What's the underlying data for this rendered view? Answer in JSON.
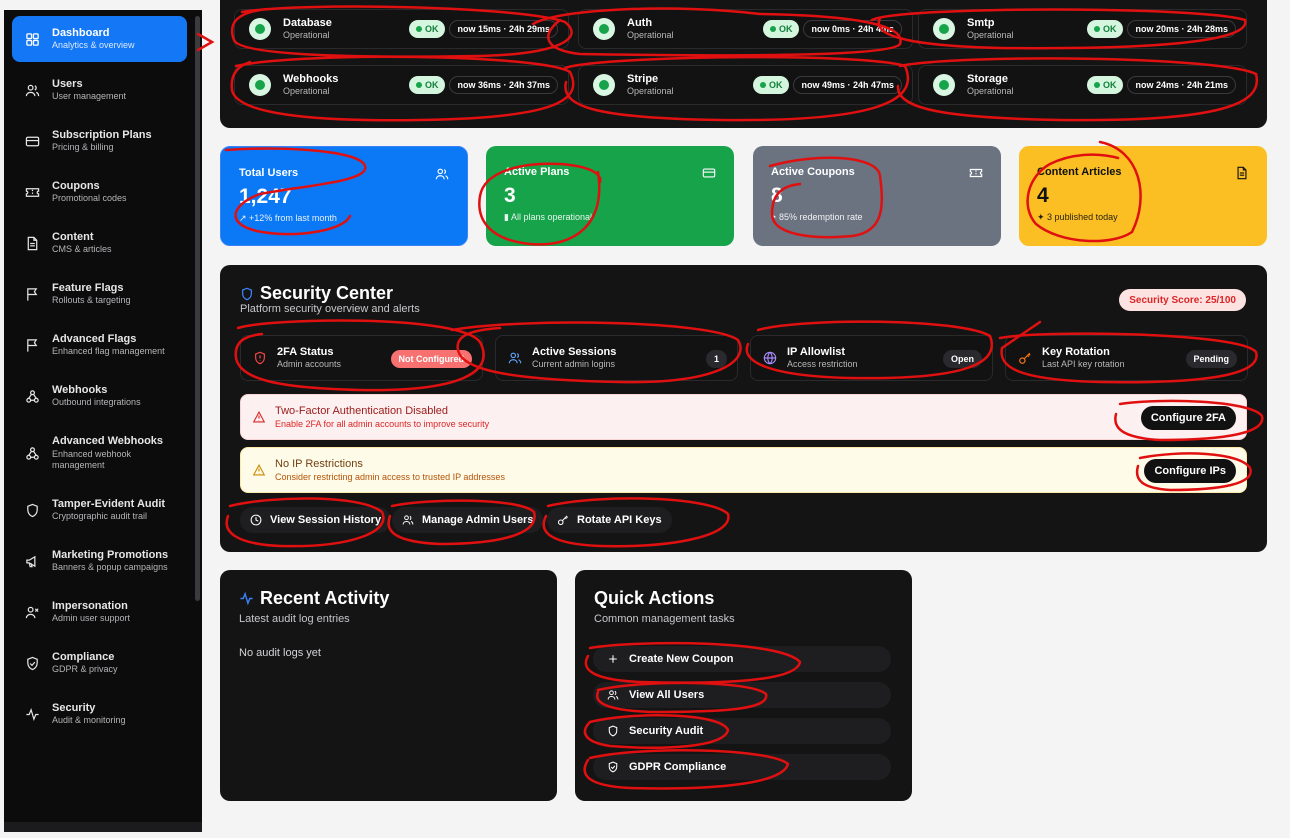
{
  "sidebar": {
    "items": [
      {
        "label": "Dashboard",
        "sub": "Analytics & overview",
        "icon": "grid-icon"
      },
      {
        "label": "Users",
        "sub": "User management",
        "icon": "users-icon"
      },
      {
        "label": "Subscription Plans",
        "sub": "Pricing & billing",
        "icon": "credit-card-icon"
      },
      {
        "label": "Coupons",
        "sub": "Promotional codes",
        "icon": "ticket-icon"
      },
      {
        "label": "Content",
        "sub": "CMS & articles",
        "icon": "file-icon"
      },
      {
        "label": "Feature Flags",
        "sub": "Rollouts & targeting",
        "icon": "flag-icon"
      },
      {
        "label": "Advanced Flags",
        "sub": "Enhanced flag management",
        "icon": "flag-icon"
      },
      {
        "label": "Webhooks",
        "sub": "Outbound integrations",
        "icon": "webhook-icon"
      },
      {
        "label": "Advanced Webhooks",
        "sub": "Enhanced webhook management",
        "icon": "webhook-icon"
      },
      {
        "label": "Tamper-Evident Audit",
        "sub": "Cryptographic audit trail",
        "icon": "shield-icon"
      },
      {
        "label": "Marketing Promotions",
        "sub": "Banners & popup campaigns",
        "icon": "megaphone-icon"
      },
      {
        "label": "Impersonation",
        "sub": "Admin user support",
        "icon": "user-x-icon"
      },
      {
        "label": "Compliance",
        "sub": "GDPR & privacy",
        "icon": "shield-check-icon"
      },
      {
        "label": "Security",
        "sub": "Audit & monitoring",
        "icon": "activity-icon"
      }
    ]
  },
  "services": [
    {
      "name": "Database",
      "status": "Operational",
      "ok": "OK",
      "time": "now 15ms · 24h 29ms"
    },
    {
      "name": "Auth",
      "status": "Operational",
      "ok": "OK",
      "time": "now 0ms · 24h 4ms"
    },
    {
      "name": "Smtp",
      "status": "Operational",
      "ok": "OK",
      "time": "now 20ms · 24h 28ms"
    },
    {
      "name": "Webhooks",
      "status": "Operational",
      "ok": "OK",
      "time": "now 36ms · 24h 37ms"
    },
    {
      "name": "Stripe",
      "status": "Operational",
      "ok": "OK",
      "time": "now 49ms · 24h 47ms"
    },
    {
      "name": "Storage",
      "status": "Operational",
      "ok": "OK",
      "time": "now 24ms · 24h 21ms"
    }
  ],
  "stats": [
    {
      "title": "Total Users",
      "value": "1,247",
      "sub": "+12% from last month",
      "color": "#0b79f6",
      "icon": "users-icon"
    },
    {
      "title": "Active Plans",
      "value": "3",
      "sub": "All plans operational",
      "color": "#16a34a",
      "icon": "credit-card-icon"
    },
    {
      "title": "Active Coupons",
      "value": "8",
      "sub": "85% redemption rate",
      "color": "#6b7280",
      "icon": "ticket-icon"
    },
    {
      "title": "Content Articles",
      "value": "4",
      "sub": "3 published today",
      "color": "#fbbf24",
      "icon": "file-icon"
    }
  ],
  "security": {
    "title": "Security Center",
    "subtitle": "Platform security overview and alerts",
    "score": "Security Score: 25/100",
    "cards": [
      {
        "title": "2FA Status",
        "sub": "Admin accounts",
        "badge": "Not Configured"
      },
      {
        "title": "Active Sessions",
        "sub": "Current admin logins",
        "badge": "1"
      },
      {
        "title": "IP Allowlist",
        "sub": "Access restriction",
        "badge": "Open"
      },
      {
        "title": "Key Rotation",
        "sub": "Last API key rotation",
        "badge": "Pending"
      }
    ],
    "alerts": [
      {
        "title": "Two-Factor Authentication Disabled",
        "sub": "Enable 2FA for all admin accounts to improve security",
        "button": "Configure 2FA"
      },
      {
        "title": "No IP Restrictions",
        "sub": "Consider restricting admin access to trusted IP addresses",
        "button": "Configure IPs"
      }
    ],
    "actions": [
      "View Session History",
      "Manage Admin Users",
      "Rotate API Keys"
    ]
  },
  "activity": {
    "title": "Recent Activity",
    "subtitle": "Latest audit log entries",
    "empty": "No audit logs yet"
  },
  "quick": {
    "title": "Quick Actions",
    "subtitle": "Common management tasks",
    "buttons": [
      "Create New Coupon",
      "View All Users",
      "Security Audit",
      "GDPR Compliance"
    ]
  }
}
